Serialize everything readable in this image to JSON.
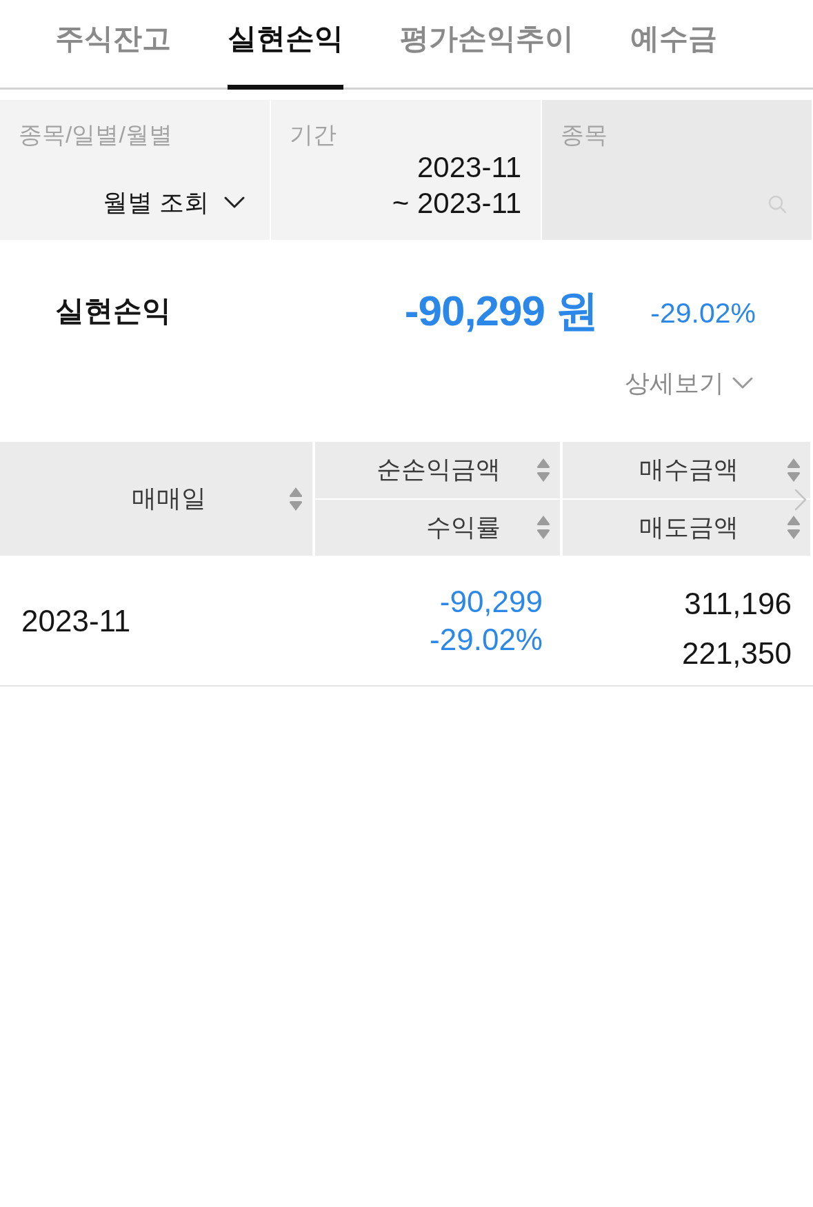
{
  "tabs": [
    {
      "label": "주식잔고",
      "selected": false
    },
    {
      "label": "실현손익",
      "selected": true
    },
    {
      "label": "평가손익추이",
      "selected": false
    },
    {
      "label": "예수금",
      "selected": false
    }
  ],
  "filters": [
    {
      "kind": "dropdown",
      "label": "종목/일별/월별",
      "value": "월별 조회"
    },
    {
      "kind": "period",
      "label": "기간",
      "lines": [
        "2023-11",
        "~ 2023-11"
      ]
    },
    {
      "kind": "search",
      "label": "종목"
    }
  ],
  "summary": {
    "label": "실현손익",
    "amount": "-90,299 원",
    "rate": "-29.02%",
    "loss": true,
    "detail_button": "상세보기"
  },
  "table": {
    "header_columns": [
      [
        "매매일"
      ],
      [
        "순손익금액",
        "수익률"
      ],
      [
        "매수금액",
        "매도금액"
      ]
    ],
    "rows": [
      {
        "cells": [
          {
            "lines": [
              "2023-11"
            ]
          },
          {
            "lines": [
              "-90,299",
              "-29.02%"
            ],
            "loss": true
          },
          {
            "lines": [
              "311,196",
              "221,350"
            ]
          }
        ]
      }
    ]
  }
}
